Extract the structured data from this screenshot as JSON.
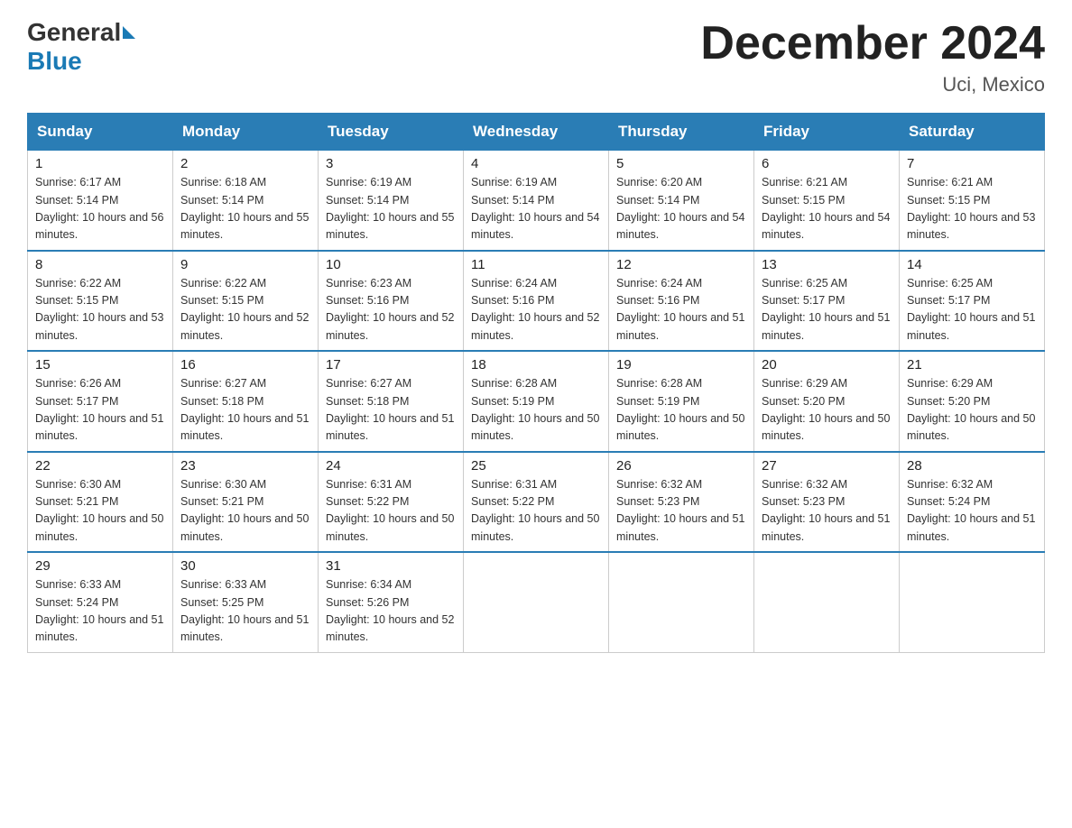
{
  "header": {
    "logo_general": "General",
    "logo_blue": "Blue",
    "title": "December 2024",
    "location": "Uci, Mexico"
  },
  "weekdays": [
    "Sunday",
    "Monday",
    "Tuesday",
    "Wednesday",
    "Thursday",
    "Friday",
    "Saturday"
  ],
  "weeks": [
    [
      {
        "day": "1",
        "sunrise": "6:17 AM",
        "sunset": "5:14 PM",
        "daylight": "10 hours and 56 minutes."
      },
      {
        "day": "2",
        "sunrise": "6:18 AM",
        "sunset": "5:14 PM",
        "daylight": "10 hours and 55 minutes."
      },
      {
        "day": "3",
        "sunrise": "6:19 AM",
        "sunset": "5:14 PM",
        "daylight": "10 hours and 55 minutes."
      },
      {
        "day": "4",
        "sunrise": "6:19 AM",
        "sunset": "5:14 PM",
        "daylight": "10 hours and 54 minutes."
      },
      {
        "day": "5",
        "sunrise": "6:20 AM",
        "sunset": "5:14 PM",
        "daylight": "10 hours and 54 minutes."
      },
      {
        "day": "6",
        "sunrise": "6:21 AM",
        "sunset": "5:15 PM",
        "daylight": "10 hours and 54 minutes."
      },
      {
        "day": "7",
        "sunrise": "6:21 AM",
        "sunset": "5:15 PM",
        "daylight": "10 hours and 53 minutes."
      }
    ],
    [
      {
        "day": "8",
        "sunrise": "6:22 AM",
        "sunset": "5:15 PM",
        "daylight": "10 hours and 53 minutes."
      },
      {
        "day": "9",
        "sunrise": "6:22 AM",
        "sunset": "5:15 PM",
        "daylight": "10 hours and 52 minutes."
      },
      {
        "day": "10",
        "sunrise": "6:23 AM",
        "sunset": "5:16 PM",
        "daylight": "10 hours and 52 minutes."
      },
      {
        "day": "11",
        "sunrise": "6:24 AM",
        "sunset": "5:16 PM",
        "daylight": "10 hours and 52 minutes."
      },
      {
        "day": "12",
        "sunrise": "6:24 AM",
        "sunset": "5:16 PM",
        "daylight": "10 hours and 51 minutes."
      },
      {
        "day": "13",
        "sunrise": "6:25 AM",
        "sunset": "5:17 PM",
        "daylight": "10 hours and 51 minutes."
      },
      {
        "day": "14",
        "sunrise": "6:25 AM",
        "sunset": "5:17 PM",
        "daylight": "10 hours and 51 minutes."
      }
    ],
    [
      {
        "day": "15",
        "sunrise": "6:26 AM",
        "sunset": "5:17 PM",
        "daylight": "10 hours and 51 minutes."
      },
      {
        "day": "16",
        "sunrise": "6:27 AM",
        "sunset": "5:18 PM",
        "daylight": "10 hours and 51 minutes."
      },
      {
        "day": "17",
        "sunrise": "6:27 AM",
        "sunset": "5:18 PM",
        "daylight": "10 hours and 51 minutes."
      },
      {
        "day": "18",
        "sunrise": "6:28 AM",
        "sunset": "5:19 PM",
        "daylight": "10 hours and 50 minutes."
      },
      {
        "day": "19",
        "sunrise": "6:28 AM",
        "sunset": "5:19 PM",
        "daylight": "10 hours and 50 minutes."
      },
      {
        "day": "20",
        "sunrise": "6:29 AM",
        "sunset": "5:20 PM",
        "daylight": "10 hours and 50 minutes."
      },
      {
        "day": "21",
        "sunrise": "6:29 AM",
        "sunset": "5:20 PM",
        "daylight": "10 hours and 50 minutes."
      }
    ],
    [
      {
        "day": "22",
        "sunrise": "6:30 AM",
        "sunset": "5:21 PM",
        "daylight": "10 hours and 50 minutes."
      },
      {
        "day": "23",
        "sunrise": "6:30 AM",
        "sunset": "5:21 PM",
        "daylight": "10 hours and 50 minutes."
      },
      {
        "day": "24",
        "sunrise": "6:31 AM",
        "sunset": "5:22 PM",
        "daylight": "10 hours and 50 minutes."
      },
      {
        "day": "25",
        "sunrise": "6:31 AM",
        "sunset": "5:22 PM",
        "daylight": "10 hours and 50 minutes."
      },
      {
        "day": "26",
        "sunrise": "6:32 AM",
        "sunset": "5:23 PM",
        "daylight": "10 hours and 51 minutes."
      },
      {
        "day": "27",
        "sunrise": "6:32 AM",
        "sunset": "5:23 PM",
        "daylight": "10 hours and 51 minutes."
      },
      {
        "day": "28",
        "sunrise": "6:32 AM",
        "sunset": "5:24 PM",
        "daylight": "10 hours and 51 minutes."
      }
    ],
    [
      {
        "day": "29",
        "sunrise": "6:33 AM",
        "sunset": "5:24 PM",
        "daylight": "10 hours and 51 minutes."
      },
      {
        "day": "30",
        "sunrise": "6:33 AM",
        "sunset": "5:25 PM",
        "daylight": "10 hours and 51 minutes."
      },
      {
        "day": "31",
        "sunrise": "6:34 AM",
        "sunset": "5:26 PM",
        "daylight": "10 hours and 52 minutes."
      },
      null,
      null,
      null,
      null
    ]
  ]
}
